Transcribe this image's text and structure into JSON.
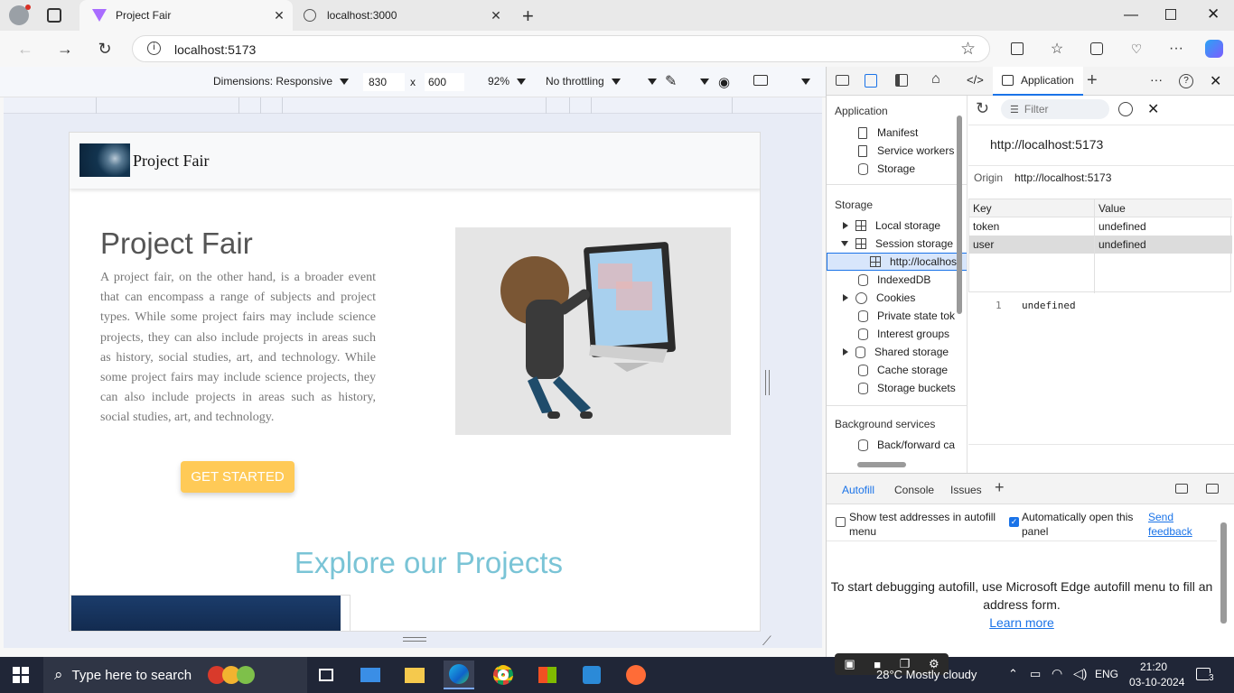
{
  "browser": {
    "tabs": [
      {
        "title": "Project Fair",
        "active": true
      },
      {
        "title": "localhost:3000",
        "active": false
      }
    ],
    "address": "localhost:5173"
  },
  "device_toolbar": {
    "dimensions": "Dimensions: Responsive",
    "width": "830",
    "x": "x",
    "height": "600",
    "zoom": "92%",
    "throttling": "No throttling"
  },
  "site": {
    "brand": "Project Fair",
    "hero_title": "Project Fair",
    "hero_text": "A project fair, on the other hand, is a broader event that can encompass a range of subjects and project types. While some project fairs may include science projects, they can also include projects in areas such as history, social studies, art, and technology. While some project fairs may include science projects, they can also include projects in areas such as history, social studies, art, and technology.",
    "cta": "GET STARTED",
    "explore_title": "Explore our Projects",
    "cta_color": "#ffca57",
    "explore_color": "#7ac4d6"
  },
  "devtools": {
    "active_tab": "Application",
    "app_section": "Application",
    "app_items": [
      "Manifest",
      "Service workers",
      "Storage"
    ],
    "storage_section": "Storage",
    "storage_items": {
      "local": "Local storage",
      "session": "Session storage",
      "session_origin": "http://localhos",
      "indexeddb": "IndexedDB",
      "cookies": "Cookies",
      "private_state": "Private state tok",
      "interest": "Interest groups",
      "shared": "Shared storage",
      "cache": "Cache storage",
      "buckets": "Storage buckets"
    },
    "bg_section": "Background services",
    "bg_item": "Back/forward ca",
    "filter_placeholder": "Filter",
    "origin_title": "http://localhost:5173",
    "origin_label": "Origin",
    "origin_value": "http://localhost:5173",
    "table": {
      "headers": [
        "Key",
        "Value"
      ],
      "rows": [
        {
          "key": "token",
          "value": "undefined",
          "selected": false
        },
        {
          "key": "user",
          "value": "undefined",
          "selected": true
        }
      ]
    },
    "preview_line": "1",
    "preview_value": "undefined",
    "drawer_tabs": [
      "Autofill",
      "Console",
      "Issues"
    ],
    "autofill": {
      "show_test": "Show test addresses in autofill menu",
      "auto_open": "Automatically open this panel",
      "send_feedback": "Send feedback",
      "message": "To start debugging autofill, use Microsoft Edge autofill menu to fill an address form.",
      "learn_more": "Learn more"
    }
  },
  "taskbar": {
    "search_placeholder": "Type here to search",
    "weather": "28°C  Mostly cloudy",
    "lang": "ENG",
    "time": "21:20",
    "date": "03-10-2024",
    "notifications": "3"
  }
}
